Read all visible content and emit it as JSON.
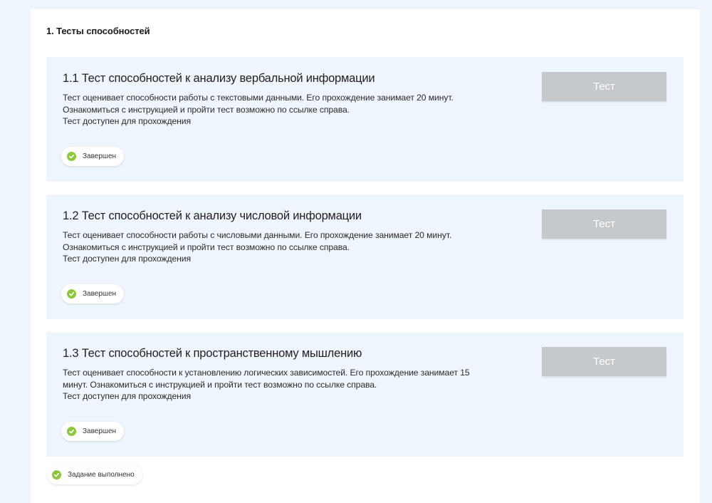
{
  "section": {
    "title": "1. Тесты способностей"
  },
  "tests": [
    {
      "title": "1.1 Тест способностей к анализу вербальной информации",
      "desc_line1": "Тест оценивает способности работы с текстовыми данными. Его прохождение занимает 20 минут.",
      "desc_line2": "Ознакомиться с инструкцией и пройти тест возможно по ссылке справа.",
      "desc_line3": "Тест доступен для прохождения",
      "button_label": "Тест",
      "status": "Завершен"
    },
    {
      "title": "1.2 Тест способностей к анализу числовой информации",
      "desc_line1": "Тест оценивает способности работы с числовыми данными. Его прохождение занимает 20 минут.",
      "desc_line2": "Ознакомиться с инструкцией и пройти тест возможно по ссылке справа.",
      "desc_line3": "Тест доступен для прохождения",
      "button_label": "Тест",
      "status": "Завершен"
    },
    {
      "title": "1.3 Тест способностей к пространственному мышлению",
      "desc_line1": "Тест оценивает способности к установлению логических зависимостей. Его прохождение занимает 15",
      "desc_line2": "минут. Ознакомиться с инструкцией и пройти тест возможно по ссылке справа.",
      "desc_line3": "Тест доступен для прохождения",
      "button_label": "Тест",
      "status": "Завершен"
    }
  ],
  "task_status": "Задание выполнено",
  "colors": {
    "page_bg": "#eef5fc",
    "block_bg": "#eef5fd",
    "button_bg": "#c6c9cc",
    "check_green": "#8cc63f"
  },
  "icons": {
    "status_icon": "check-circle-icon"
  }
}
